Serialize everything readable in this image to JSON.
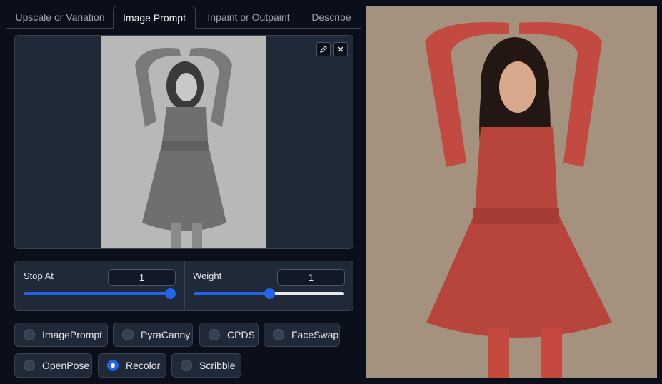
{
  "tabs": [
    {
      "label": "Upscale or Variation",
      "active": false
    },
    {
      "label": "Image Prompt",
      "active": true
    },
    {
      "label": "Inpaint or Outpaint",
      "active": false
    },
    {
      "label": "Describe",
      "active": false
    }
  ],
  "sliders": {
    "stop_at": {
      "label": "Stop At",
      "value": "1",
      "fraction": 1.0
    },
    "weight": {
      "label": "Weight",
      "value": "1",
      "fraction": 0.5
    }
  },
  "radios": [
    {
      "label": "ImagePrompt",
      "selected": false
    },
    {
      "label": "PyraCanny",
      "selected": false
    },
    {
      "label": "CPDS",
      "selected": false
    },
    {
      "label": "FaceSwap",
      "selected": false
    },
    {
      "label": "OpenPose",
      "selected": false
    },
    {
      "label": "Recolor",
      "selected": true
    },
    {
      "label": "Scribble",
      "selected": false
    }
  ],
  "icons": {
    "edit": "pencil-icon",
    "close": "close-icon"
  },
  "colors": {
    "accent": "#2563eb",
    "panel": "#1f2937",
    "background": "#0b0f19"
  }
}
